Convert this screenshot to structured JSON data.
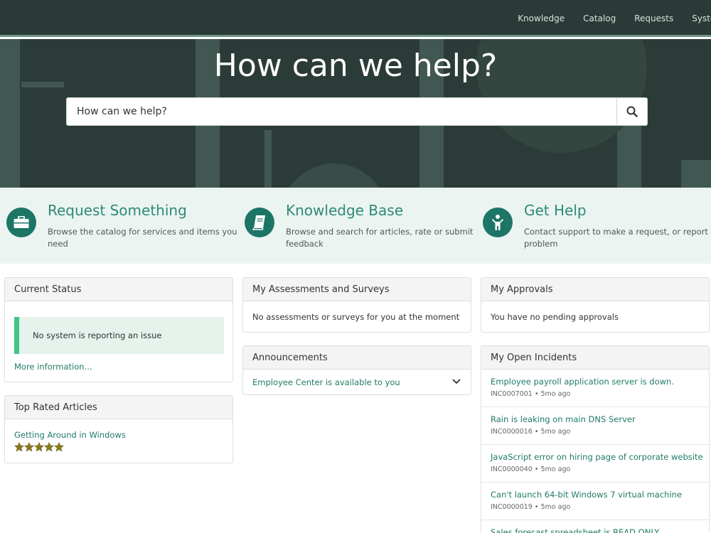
{
  "nav": {
    "items": [
      "Knowledge",
      "Catalog",
      "Requests",
      "System"
    ]
  },
  "hero": {
    "title": "How can we help?",
    "search_placeholder": "How can we help?"
  },
  "quick_links": [
    {
      "title": "Request Something",
      "desc": "Browse the catalog for services and items you need",
      "icon": "briefcase-icon"
    },
    {
      "title": "Knowledge Base",
      "desc": "Browse and search for articles, rate or submit feedback",
      "icon": "book-icon"
    },
    {
      "title": "Get Help",
      "desc": "Contact support to make a request, or report a problem",
      "icon": "person-help-icon"
    }
  ],
  "current_status": {
    "title": "Current Status",
    "message": "No system is reporting an issue",
    "more_link": "More information..."
  },
  "top_rated": {
    "title": "Top Rated Articles",
    "article": "Getting Around in Windows",
    "rating": 5
  },
  "assessments": {
    "title": "My Assessments and Surveys",
    "message": "No assessments or surveys for you at the moment"
  },
  "announcements": {
    "title": "Announcements",
    "item": "Employee Center is available to you"
  },
  "approvals": {
    "title": "My Approvals",
    "message": "You have no pending approvals"
  },
  "incidents": {
    "title": "My Open Incidents",
    "items": [
      {
        "title": "Employee payroll application server is down.",
        "meta": "INC0007001 • 5mo ago"
      },
      {
        "title": "Rain is leaking on main DNS Server",
        "meta": "INC0000016 • 5mo ago"
      },
      {
        "title": "JavaScript error on hiring page of corporate website",
        "meta": "INC0000040 • 5mo ago"
      },
      {
        "title": "Can't launch 64-bit Windows 7 virtual machine",
        "meta": "INC0000019 • 5mo ago"
      },
      {
        "title": "Sales forecast spreadsheet is READ ONLY",
        "meta": ""
      }
    ]
  },
  "colors": {
    "nav_bg": "#2a3a37",
    "accent": "#1d7566",
    "link": "#1f7a67",
    "status_bar": "#43c484",
    "star": "#8a7a1e"
  }
}
